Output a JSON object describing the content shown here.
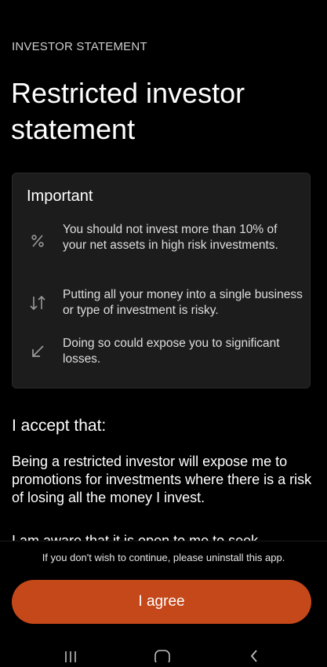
{
  "header": {
    "eyebrow": "INVESTOR STATEMENT",
    "title": "Restricted investor statement"
  },
  "important": {
    "title": "Important",
    "items": [
      {
        "icon": "percent-icon",
        "text": "You should not invest more than 10% of your net assets in high risk investments."
      },
      {
        "icon": "swap-vertical-icon",
        "text": "Putting all your money into a single business or type of investment is risky."
      },
      {
        "icon": "arrow-down-left-icon",
        "text": "Doing so could expose you to significant losses."
      }
    ]
  },
  "accept": {
    "title": "I accept that:",
    "paragraph": "Being a restricted investor will expose me to promotions for investments where there is a risk of losing all the money I invest.",
    "next_paragraph_partial": "I am aware that it is open to me to seek"
  },
  "footer": {
    "note": "If you don't wish to continue, please uninstall this app.",
    "agree_label": "I agree"
  },
  "system_nav": {
    "buttons": [
      "recents-icon",
      "home-icon",
      "back-icon"
    ]
  },
  "colors": {
    "background": "#000000",
    "card": "#1c1c1c",
    "accent": "#c5481a"
  }
}
